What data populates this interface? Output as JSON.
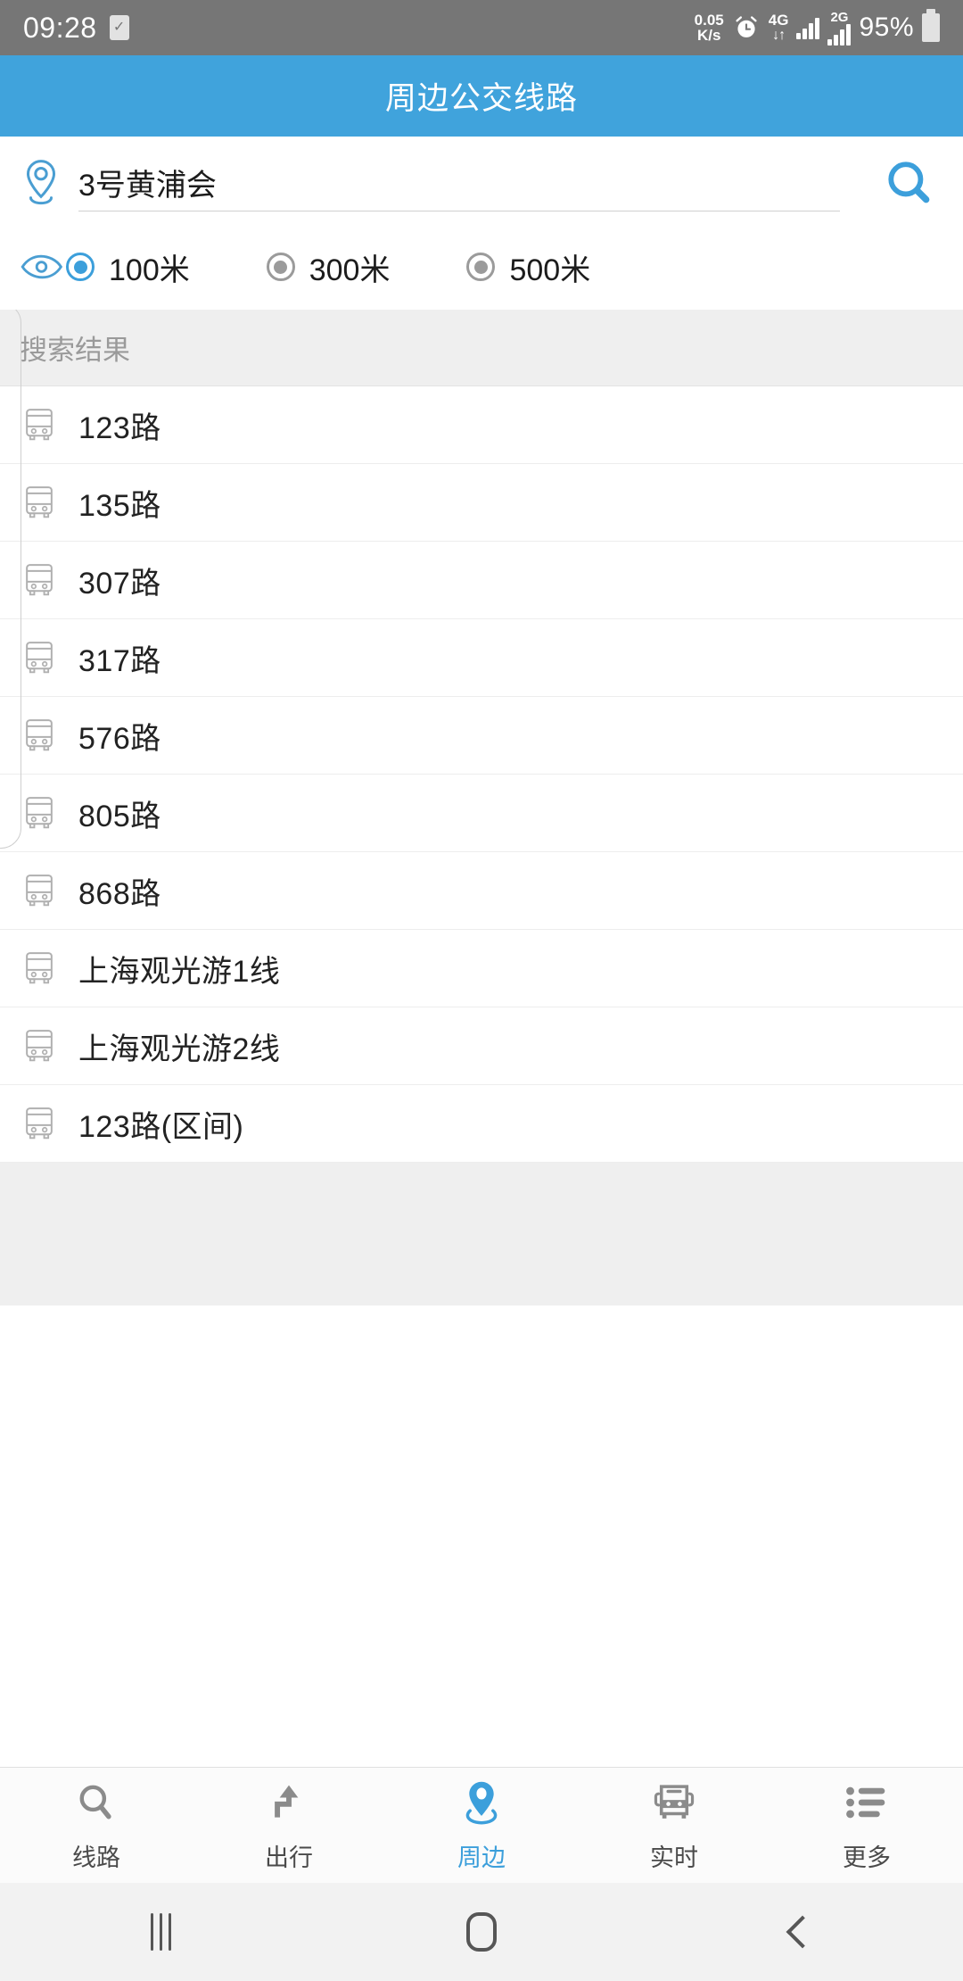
{
  "status_bar": {
    "time": "09:28",
    "check_icon": "✓",
    "data_rate_value": "0.05",
    "data_rate_unit": "K/s",
    "alarm_icon": "alarm-clock",
    "network_type": "4G",
    "network_arrows": "↓↑",
    "second_sim_label": "2G",
    "battery_percent": "95%"
  },
  "header": {
    "title": "周边公交线路"
  },
  "search": {
    "pin_icon": "location-pin-icon",
    "query_value": "3号黄浦会",
    "search_icon": "search-icon",
    "eye_icon": "eye-icon",
    "radius_options": [
      {
        "label": "100米",
        "selected": true
      },
      {
        "label": "300米",
        "selected": false
      },
      {
        "label": "500米",
        "selected": false
      }
    ]
  },
  "results": {
    "section_title": "搜索结果",
    "items": [
      {
        "icon": "bus-icon",
        "name": "123路"
      },
      {
        "icon": "bus-icon",
        "name": "135路"
      },
      {
        "icon": "bus-icon",
        "name": "307路"
      },
      {
        "icon": "bus-icon",
        "name": "317路"
      },
      {
        "icon": "bus-icon",
        "name": "576路"
      },
      {
        "icon": "bus-icon",
        "name": "805路"
      },
      {
        "icon": "bus-icon",
        "name": "868路"
      },
      {
        "icon": "bus-icon",
        "name": "上海观光游1线"
      },
      {
        "icon": "bus-icon",
        "name": "上海观光游2线"
      },
      {
        "icon": "bus-icon",
        "name": "123路(区间)"
      }
    ]
  },
  "tabbar": {
    "tabs": [
      {
        "label": "线路",
        "icon": "search-icon",
        "active": false
      },
      {
        "label": "出行",
        "icon": "route-arrow-icon",
        "active": false
      },
      {
        "label": "周边",
        "icon": "location-pin-icon",
        "active": true
      },
      {
        "label": "实时",
        "icon": "bus-icon",
        "active": false
      },
      {
        "label": "更多",
        "icon": "list-icon",
        "active": false
      }
    ]
  },
  "android_nav": {
    "recents_label": "recents-button",
    "home_label": "home-button",
    "back_label": "back-button"
  },
  "colors": {
    "accent": "#3c9fdb",
    "header_bg": "#40a3dc",
    "status_bg": "#767676",
    "section_bg": "#efefef"
  }
}
